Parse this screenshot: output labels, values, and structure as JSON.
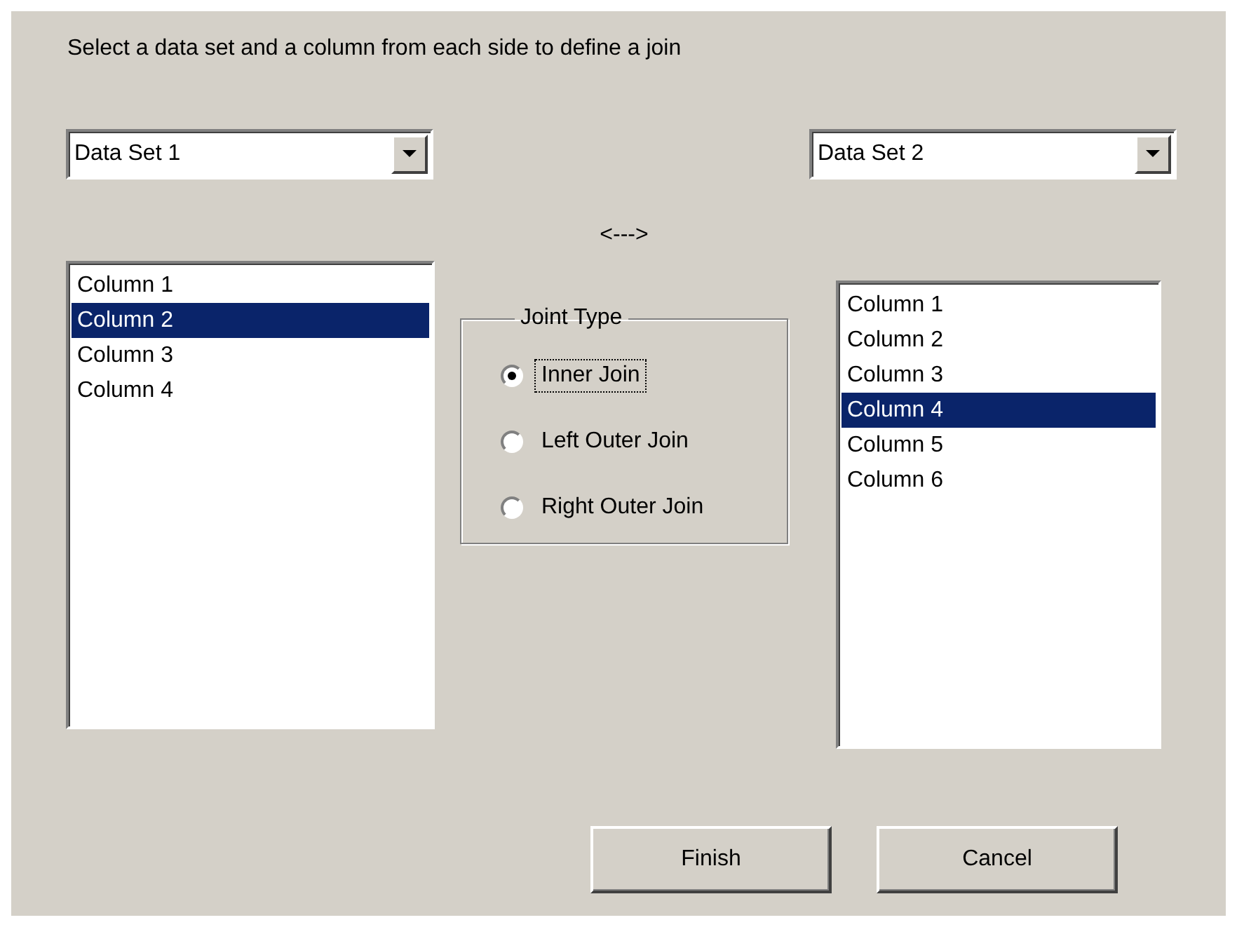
{
  "instruction": "Select a data set and a column from each side to define a join",
  "left": {
    "dropdown": {
      "value": "Data Set 1"
    },
    "columns": [
      {
        "label": "Column 1",
        "selected": false
      },
      {
        "label": "Column 2",
        "selected": true
      },
      {
        "label": "Column 3",
        "selected": false
      },
      {
        "label": "Column 4",
        "selected": false
      }
    ]
  },
  "arrow": "<--->",
  "join_type": {
    "title": "Joint Type",
    "options": [
      {
        "label": "Inner Join",
        "selected": true,
        "focused": true
      },
      {
        "label": "Left Outer Join",
        "selected": false,
        "focused": false
      },
      {
        "label": "Right Outer Join",
        "selected": false,
        "focused": false
      }
    ]
  },
  "right": {
    "dropdown": {
      "value": "Data Set 2"
    },
    "columns": [
      {
        "label": "Column 1",
        "selected": false
      },
      {
        "label": "Column 2",
        "selected": false
      },
      {
        "label": "Column 3",
        "selected": false
      },
      {
        "label": "Column 4",
        "selected": true
      },
      {
        "label": "Column 5",
        "selected": false
      },
      {
        "label": "Column 6",
        "selected": false
      }
    ]
  },
  "buttons": [
    "Finish",
    "Cancel"
  ]
}
